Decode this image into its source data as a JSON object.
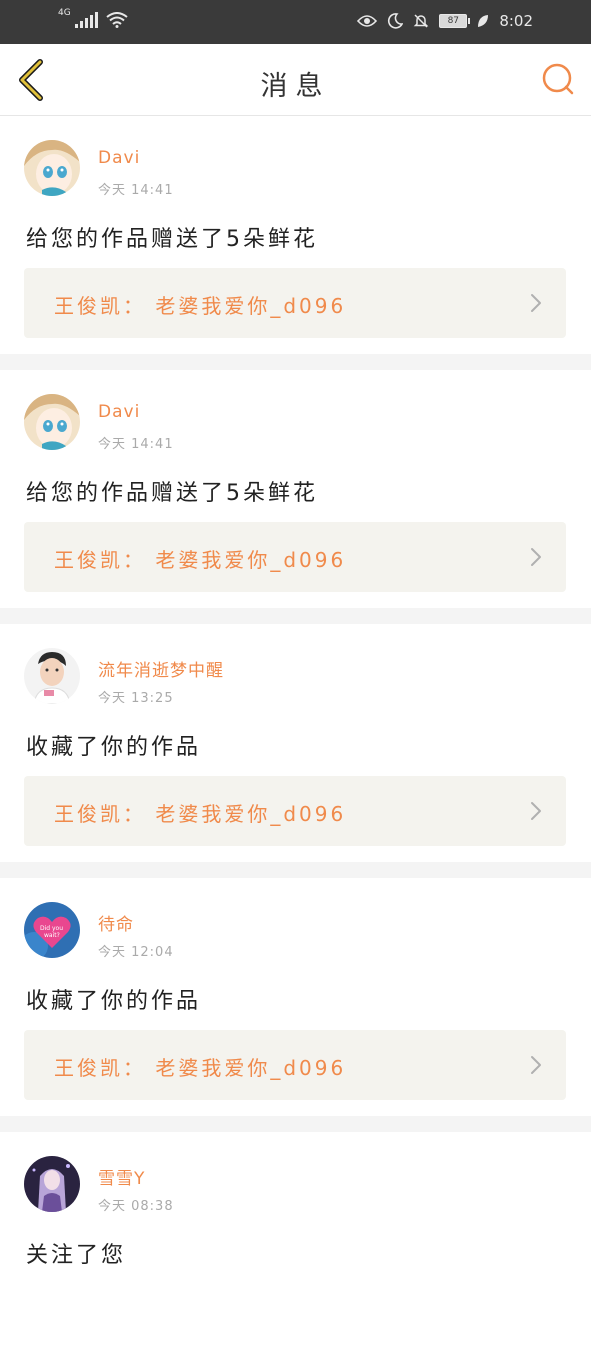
{
  "status_bar": {
    "network": "4G",
    "battery": "87",
    "time": "8:02"
  },
  "header": {
    "title": "消息",
    "back_icon": "back-chevron-icon",
    "search_icon": "search-icon"
  },
  "colors": {
    "accent": "#f08a4b",
    "back_icon": "#d6b32a",
    "card_bg": "#f4f3ee"
  },
  "messages": [
    {
      "username": "Davi",
      "time": "今天 14:41",
      "action": "给您的作品赠送了5朵鲜花",
      "work_title": "王俊凯：  老婆我爱你_d096"
    },
    {
      "username": "Davi",
      "time": "今天 14:41",
      "action": "给您的作品赠送了5朵鲜花",
      "work_title": "王俊凯：  老婆我爱你_d096"
    },
    {
      "username": "流年消逝梦中醒",
      "time": "今天 13:25",
      "action": "收藏了你的作品",
      "work_title": "王俊凯：  老婆我爱你_d096"
    },
    {
      "username": "待命",
      "time": "今天 12:04",
      "action": "收藏了你的作品",
      "work_title": "王俊凯：  老婆我爱你_d096"
    },
    {
      "username": "雪雪Y",
      "time": "今天 08:38",
      "action": "关注了您"
    }
  ]
}
